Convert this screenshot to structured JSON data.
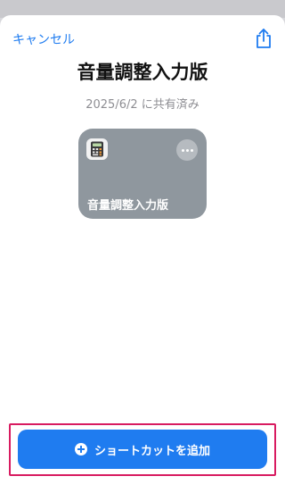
{
  "header": {
    "cancel_label": "キャンセル"
  },
  "shortcut": {
    "title": "音量調整入力版",
    "shared_text": "2025/6/2 に共有済み",
    "card_label": "音量調整入力版",
    "icon": "calculator-icon"
  },
  "actions": {
    "add_label": "ショートカットを追加"
  },
  "colors": {
    "accent": "#1f7cf0",
    "card": "#8f979e",
    "highlight": "#d81b60"
  }
}
